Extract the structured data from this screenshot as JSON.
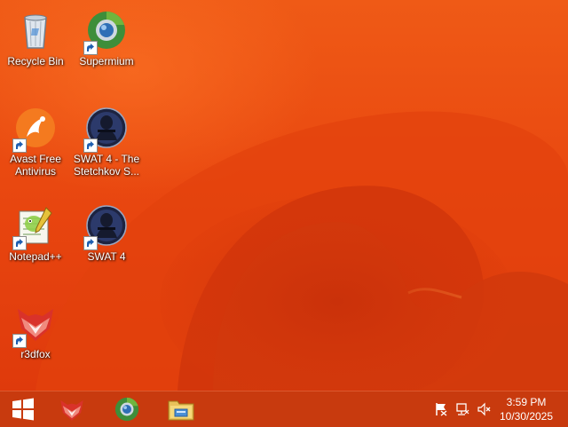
{
  "desktop": {
    "icons": [
      {
        "label": "Recycle Bin",
        "icon": "recycle-bin-icon",
        "shortcut": false
      },
      {
        "label": "Supermium",
        "icon": "supermium-icon",
        "shortcut": true
      },
      {
        "label": "Avast Free Antivirus",
        "icon": "avast-icon",
        "shortcut": true
      },
      {
        "label": "SWAT 4 - The Stetchkov S...",
        "icon": "swat4-expansion-icon",
        "shortcut": true
      },
      {
        "label": "Notepad++",
        "icon": "notepad-plus-plus-icon",
        "shortcut": true
      },
      {
        "label": "SWAT 4",
        "icon": "swat4-icon",
        "shortcut": true
      },
      {
        "label": "r3dfox",
        "icon": "r3dfox-icon",
        "shortcut": true
      }
    ]
  },
  "taskbar": {
    "start": "windows-start-icon",
    "pinned": [
      "r3dfox-icon",
      "supermium-icon",
      "file-explorer-icon"
    ],
    "tray": [
      "action-center-flag-icon",
      "network-icon",
      "volume-muted-icon"
    ],
    "time": "3:59 PM",
    "date": "10/30/2025"
  },
  "colors": {
    "wallpaper": "#e84a10",
    "taskbar": "#c4380e"
  }
}
